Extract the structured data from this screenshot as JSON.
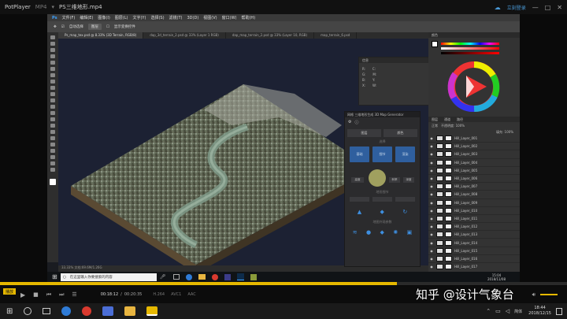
{
  "player": {
    "app_name": "PotPlayer",
    "format": "MP4",
    "file_name": "PS三维地形.mp4",
    "play_label": "播放",
    "time_current": "00:18:12",
    "time_total": "00:20:35",
    "progress": 0.7,
    "codec1": "H.264",
    "codec2": "AVC1",
    "codec3": "AAC",
    "account": "立刻登录"
  },
  "ps": {
    "menu": [
      "文件(F)",
      "编辑(E)",
      "图像(I)",
      "图层(L)",
      "文字(Y)",
      "选择(S)",
      "滤镜(T)",
      "3D(D)",
      "视图(V)",
      "窗口(W)",
      "帮助(H)"
    ],
    "options": [
      "自动选择",
      "图层",
      "显示变换控件"
    ],
    "tabs": [
      "Ps_map_tex.psd @ 8.33% (3D Terrain, RGB/8)",
      "dap_3d_terrain_2.psd @ 33% (Layer 1 RGB)",
      "dap_map_terrain_2.psd @ 33% (Layer 10, RGB)",
      "map_terrain_6.psd"
    ],
    "status": "33.33%   文档:69.6M/1.26G",
    "info_title": "信息",
    "color_title": "颜色",
    "layers_title": "图层",
    "layers_tabs": [
      "图层",
      "通道",
      "路径"
    ],
    "blend_mode": "正常",
    "opacity_label": "不透明度: 100%",
    "fill_label": "填充: 100%",
    "layers": [
      "Hill_Layer_001",
      "Hill_Layer_002",
      "Hill_Layer_003",
      "Hill_Layer_004",
      "Hill_Layer_005",
      "Hill_Layer_006",
      "Hill_Layer_007",
      "Hill_Layer_008",
      "Hill_Layer_009",
      "Hill_Layer_010",
      "Hill_Layer_011",
      "Hill_Layer_012",
      "Hill_Layer_013",
      "Hill_Layer_014",
      "Hill_Layer_015",
      "Hill_Layer_016",
      "Hill_Layer_017"
    ]
  },
  "generator": {
    "title": "网格 三维地形生成 3D Map Generator",
    "tab1": "图层",
    "tab2": "颜色",
    "btn_left": "基础",
    "btn_mid": "细节",
    "btn_right": "渲染",
    "lbl_top": "选择",
    "lbl_mid": "地形细节",
    "lbl_bottom": "地图外观参数",
    "small1": "高度",
    "small2": "斜率",
    "small3": "深度"
  },
  "taskbar": {
    "search_placeholder": "在这里输入你要搜索的内容",
    "time": "15:04",
    "date": "2018/11/08"
  },
  "host": {
    "time": "18:44",
    "date": "2018/12/15",
    "lang": "简体"
  },
  "watermark": "知乎 @设计气象台"
}
